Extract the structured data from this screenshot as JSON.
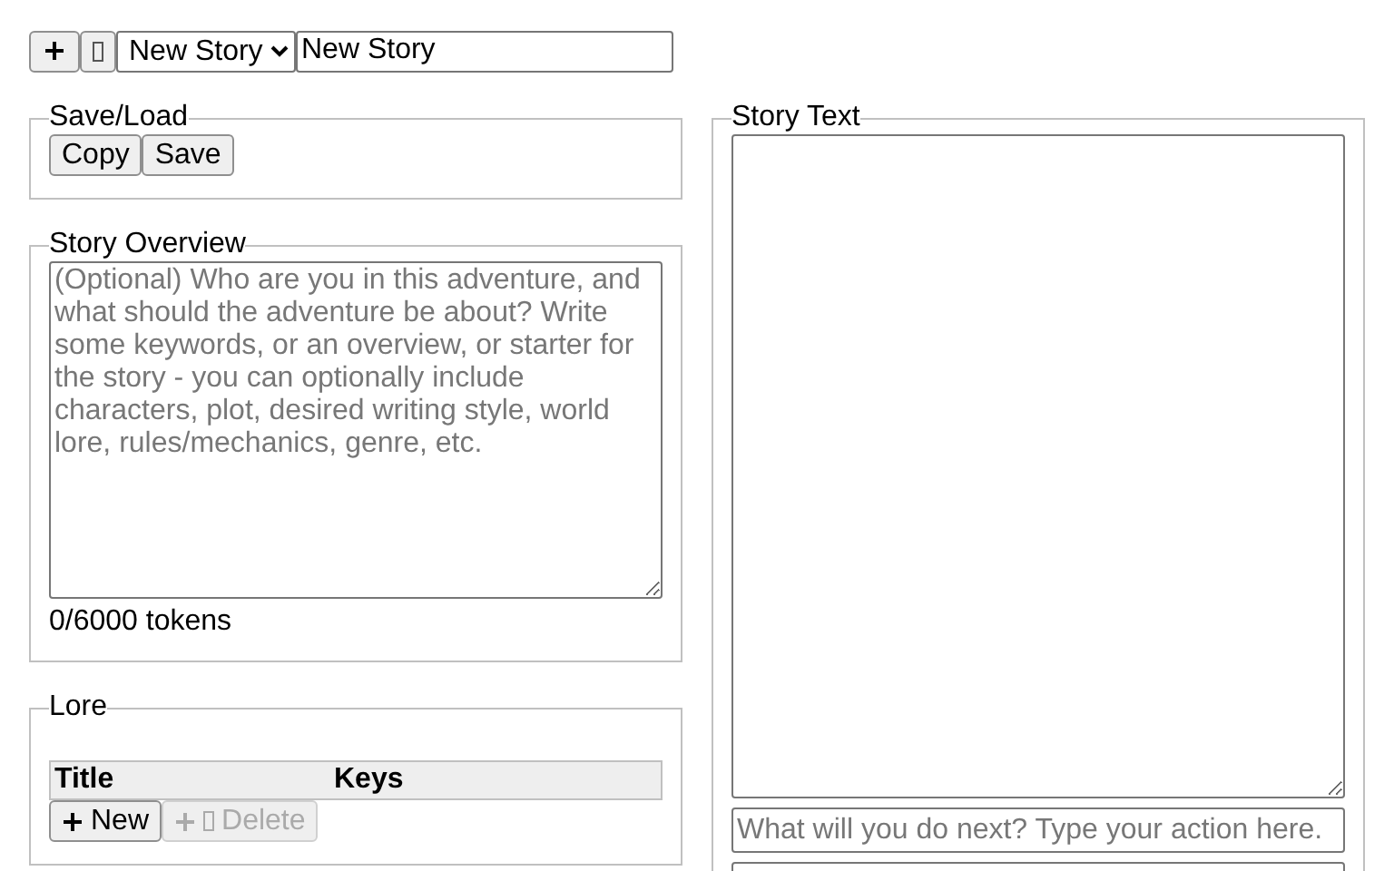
{
  "toolbar": {
    "story_select": {
      "value": "New Story"
    },
    "title_field": {
      "value": "New Story"
    }
  },
  "save_load": {
    "legend": "Save/Load",
    "buttons": [
      "Copy",
      "Save"
    ]
  },
  "overview": {
    "legend": "Story Overview",
    "placeholder": "(Optional) Who are you in this adventure, and what should the adventure be about? Write some keywords, or an overview, or starter for the story - you can optionally include characters, plot, desired writing style, world lore, rules/mechanics, genre, etc.",
    "token_count": "0/6000 tokens"
  },
  "lore": {
    "legend": "Lore",
    "columns": [
      "Title",
      "Keys"
    ],
    "buttons": [
      {
        "kind": "new",
        "label": "New",
        "disabled": false
      },
      {
        "kind": "delete",
        "label": "Delete",
        "disabled": true
      }
    ]
  },
  "story_text": {
    "legend": "Story Text",
    "action_placeholder": "What will you do next? Type your action here."
  }
}
